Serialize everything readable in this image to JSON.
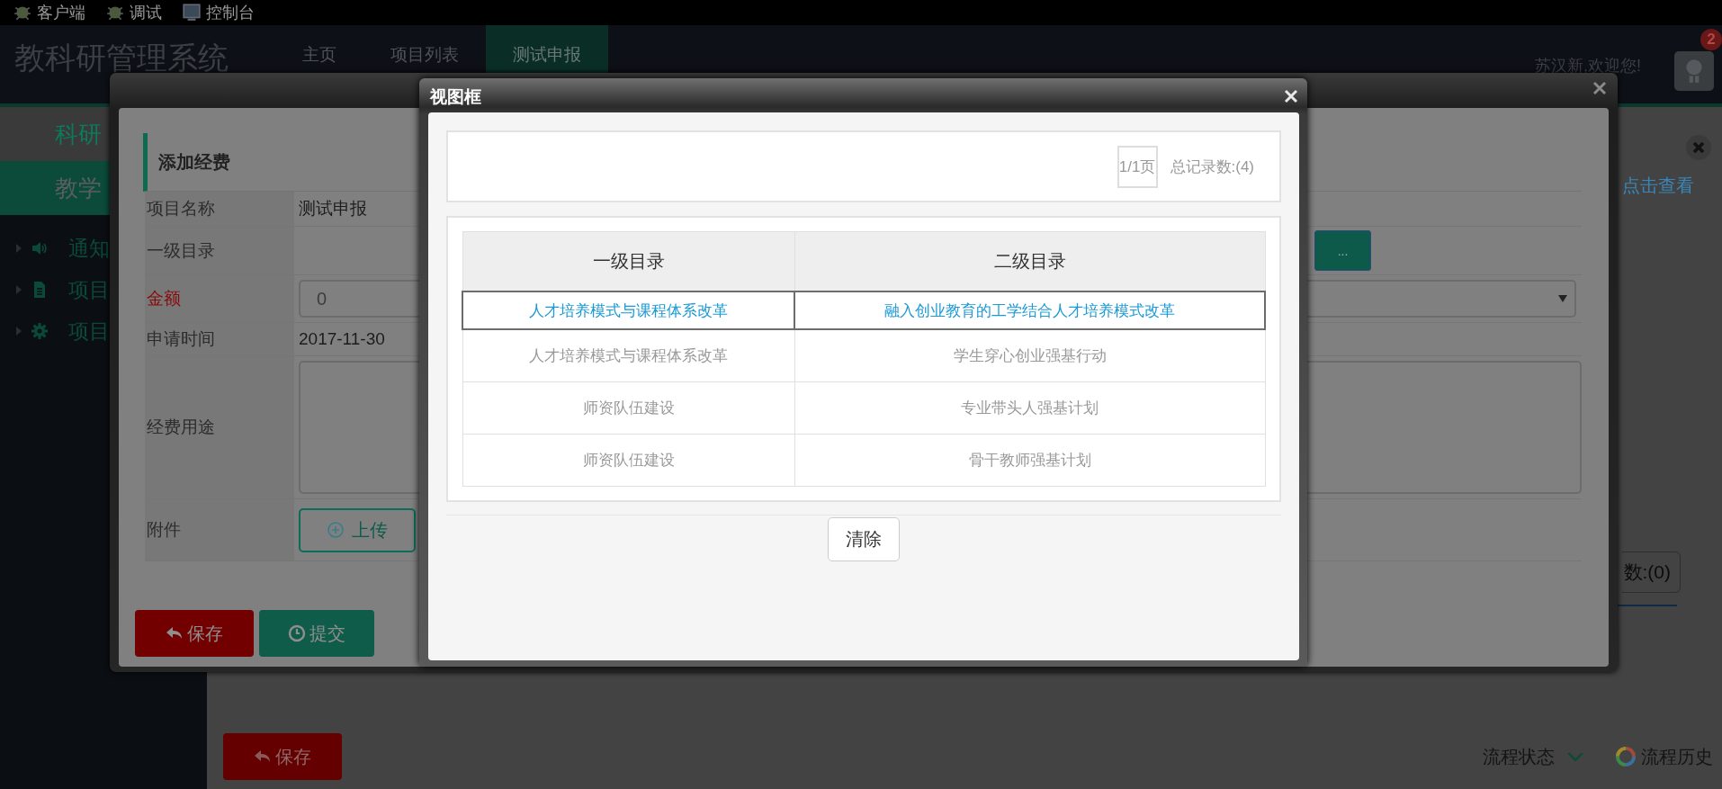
{
  "toolbar": [
    {
      "kind": "bug",
      "label": "客户端"
    },
    {
      "kind": "bug",
      "label": "调试"
    },
    {
      "kind": "monitor",
      "label": "控制台"
    }
  ],
  "header": {
    "title": "教科研管理系统",
    "nav": [
      {
        "label": "主页",
        "selected": false
      },
      {
        "label": "项目列表",
        "selected": false
      },
      {
        "label": "测试申报",
        "selected": true
      }
    ],
    "greeting": "苏汉新,欢迎您!",
    "badge": "2"
  },
  "sidebar": {
    "sections": [
      {
        "label": "科研",
        "selected": false
      },
      {
        "label": "教学",
        "selected": true
      }
    ],
    "items": [
      {
        "kind": "notice",
        "label": "通知"
      },
      {
        "kind": "document",
        "label": "项目"
      },
      {
        "kind": "settings",
        "label": "项目"
      }
    ]
  },
  "page": {
    "link": "点击查看",
    "record_count": "数:(0)",
    "save_button": "保存",
    "flow_status": "流程状态",
    "flow_history": "流程历史"
  },
  "expense_dialog": {
    "title": "添加经费",
    "fields": [
      {
        "kind": "text",
        "label": "项目名称",
        "value": "测试申报",
        "required": false
      },
      {
        "kind": "picker",
        "label": "一级目录",
        "button": "...",
        "required": false
      },
      {
        "kind": "amount",
        "label": "金额",
        "value": "0",
        "required": true
      },
      {
        "kind": "text",
        "label": "申请时间",
        "value": "2017-11-30",
        "required": false
      },
      {
        "kind": "textarea",
        "label": "经费用途",
        "required": false
      },
      {
        "kind": "upload",
        "label": "附件",
        "button": "上传",
        "required": false
      }
    ],
    "buttons": [
      {
        "kind": "save",
        "label": "保存"
      },
      {
        "kind": "submit",
        "label": "提交"
      }
    ]
  },
  "view_dialog": {
    "title": "视图框",
    "pager": {
      "page": "1/1页",
      "total": "总记录数:(4)"
    },
    "table": {
      "columns": [
        "一级目录",
        "二级目录"
      ],
      "rows": [
        {
          "cells": [
            "人才培养模式与课程体系改革",
            "融入创业教育的工学结合人才培养模式改革"
          ],
          "selected": true
        },
        {
          "cells": [
            "人才培养模式与课程体系改革",
            "学生穿心创业强基行动"
          ],
          "selected": false
        },
        {
          "cells": [
            "师资队伍建设",
            "专业带头人强基计划"
          ],
          "selected": false
        },
        {
          "cells": [
            "师资队伍建设",
            "骨干教师强基计划"
          ],
          "selected": false
        }
      ]
    },
    "clear_button": "清除"
  }
}
